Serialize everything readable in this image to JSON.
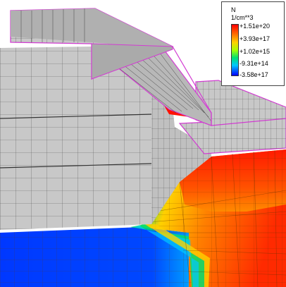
{
  "legend": {
    "quantity": "N",
    "unit": "1/cm**3",
    "ticks": [
      "+1.51e+20",
      "+3.93e+17",
      "+1.02e+15",
      "-9.31e+14",
      "-3.58e+17"
    ]
  },
  "colors": {
    "gray_mesh": "#c8c8c8",
    "mesh_line": "#555555",
    "outline": "#d23cd2",
    "red": "#ff2000",
    "orange": "#ff8000",
    "yellow": "#ffd000",
    "green": "#00d060",
    "cyan": "#00c8ff",
    "blue": "#0040ff"
  }
}
